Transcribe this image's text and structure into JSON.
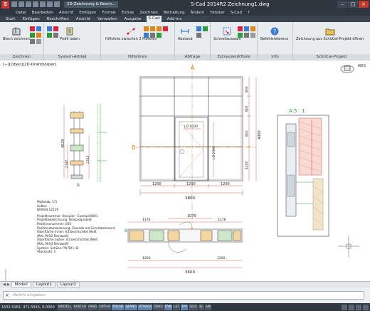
{
  "titlebar": {
    "logo": "S",
    "doc_tab": "2D-Zeichnung & Besch...",
    "title": "S-Cad 2014R2     Zeichnung1.dwg"
  },
  "menu": [
    "Datei",
    "Bearbeiten",
    "Ansicht",
    "Einfügen",
    "Format",
    "Extras",
    "Zeichnen",
    "Bemaßung",
    "Ändern",
    "Fenster",
    "S-Cad",
    "?"
  ],
  "tabs": [
    "Start",
    "Einfügen",
    "Beschriften",
    "Ansicht",
    "Verwalten",
    "Ausgabe",
    "S-Cad",
    "Add-ins"
  ],
  "active_tab": "S-Cad",
  "ribbon": {
    "groups": [
      {
        "title": "Zeichnen",
        "buttons": [
          "Blech zeichnen"
        ]
      },
      {
        "title": "System-Artikel",
        "buttons": [
          "Profil laden"
        ]
      },
      {
        "title": "Hilfslinien",
        "buttons": [
          "Hilfslinie zwischen 2 Punkten"
        ]
      },
      {
        "title": "Abfrage",
        "buttons": [
          "Abstand"
        ]
      },
      {
        "title": "Extras/workTools",
        "buttons": [
          "Schnellauswahl"
        ]
      },
      {
        "title": "Info",
        "buttons": [
          "Befehlsreferenz"
        ]
      },
      {
        "title": "SchüCal-Projekt",
        "buttons": [
          "Zeichnung aus SchüCal-Projekt öffnen"
        ]
      }
    ]
  },
  "viewport": {
    "label": "[−][Oben][2D-Drahtkörper]",
    "wcs": "WKS"
  },
  "drawing": {
    "section_a": "A",
    "section_b": "B",
    "detail_title": "A 5 : 1",
    "dims": {
      "width_3800": "3800",
      "width_1200a": "1200",
      "width_1200b": "1200",
      "width_1200c": "1200",
      "height_4000": "4000",
      "height_800a": "800",
      "height_800b": "800",
      "height_800c": "800",
      "height_1200": "1200",
      "door_lw_1030": "LD 1030",
      "door_lh_2360": "LD 2360",
      "left_4025": "4025",
      "left_2140": "2140",
      "left_2352": "2352",
      "plan_3600": "3600",
      "plan_1070": "1070",
      "plan_1200a": "1200",
      "plan_1200b": "1200",
      "plan_1176a": "1176",
      "plan_1176b": "1176",
      "plan_1200c": "1200",
      "plan_1200d": "1200"
    },
    "notes": [
      "Maßstab: 1:5",
      "Außen",
      "DIN EN 12519",
      "",
      "Projektnummer: Beispiel - Exemplr0001",
      "Projektbezeichnung: Beispielprojekt",
      "Positionsnummer: 056",
      "Positionsbezeichnung: Fassade mit Einsatzelement",
      "Oberfläche innen: K3 beschichtet Weiß",
      "  (RAL 9010 Reinweiß)",
      "Oberfläche außen: K3 beschichtet Weiß",
      "  (RAL 9010 Reinweiß)",
      "System: Schüco FW 50+.SI",
      "Stückzahl: 1"
    ]
  },
  "layout_tabs": [
    "Modell",
    "Layout1",
    "Layout2"
  ],
  "active_layout": "Modell",
  "command": {
    "placeholder": "Befehl eingeben"
  },
  "status": {
    "coords": "1632.0161, 471.5915, 0.0000",
    "buttons": [
      "MODELL",
      "RASTER",
      "FANG",
      "ORTHO",
      "POLAR",
      "OFANG",
      "OTRACK",
      "DBKS",
      "DYN",
      "LST",
      "TPY",
      "SEIG",
      "SC",
      "AM"
    ],
    "active": [
      "POLAR",
      "OFANG",
      "OTRACK",
      "DYN",
      "TPY"
    ]
  },
  "colors": {
    "chrome_dark": "#2e3640",
    "ribbon_bg": "#e9ecef",
    "section_orange": "#e0861a",
    "dim_red": "#c0392b",
    "glass_green": "#2e9e3b",
    "wood_brown": "#9a7b4f"
  }
}
